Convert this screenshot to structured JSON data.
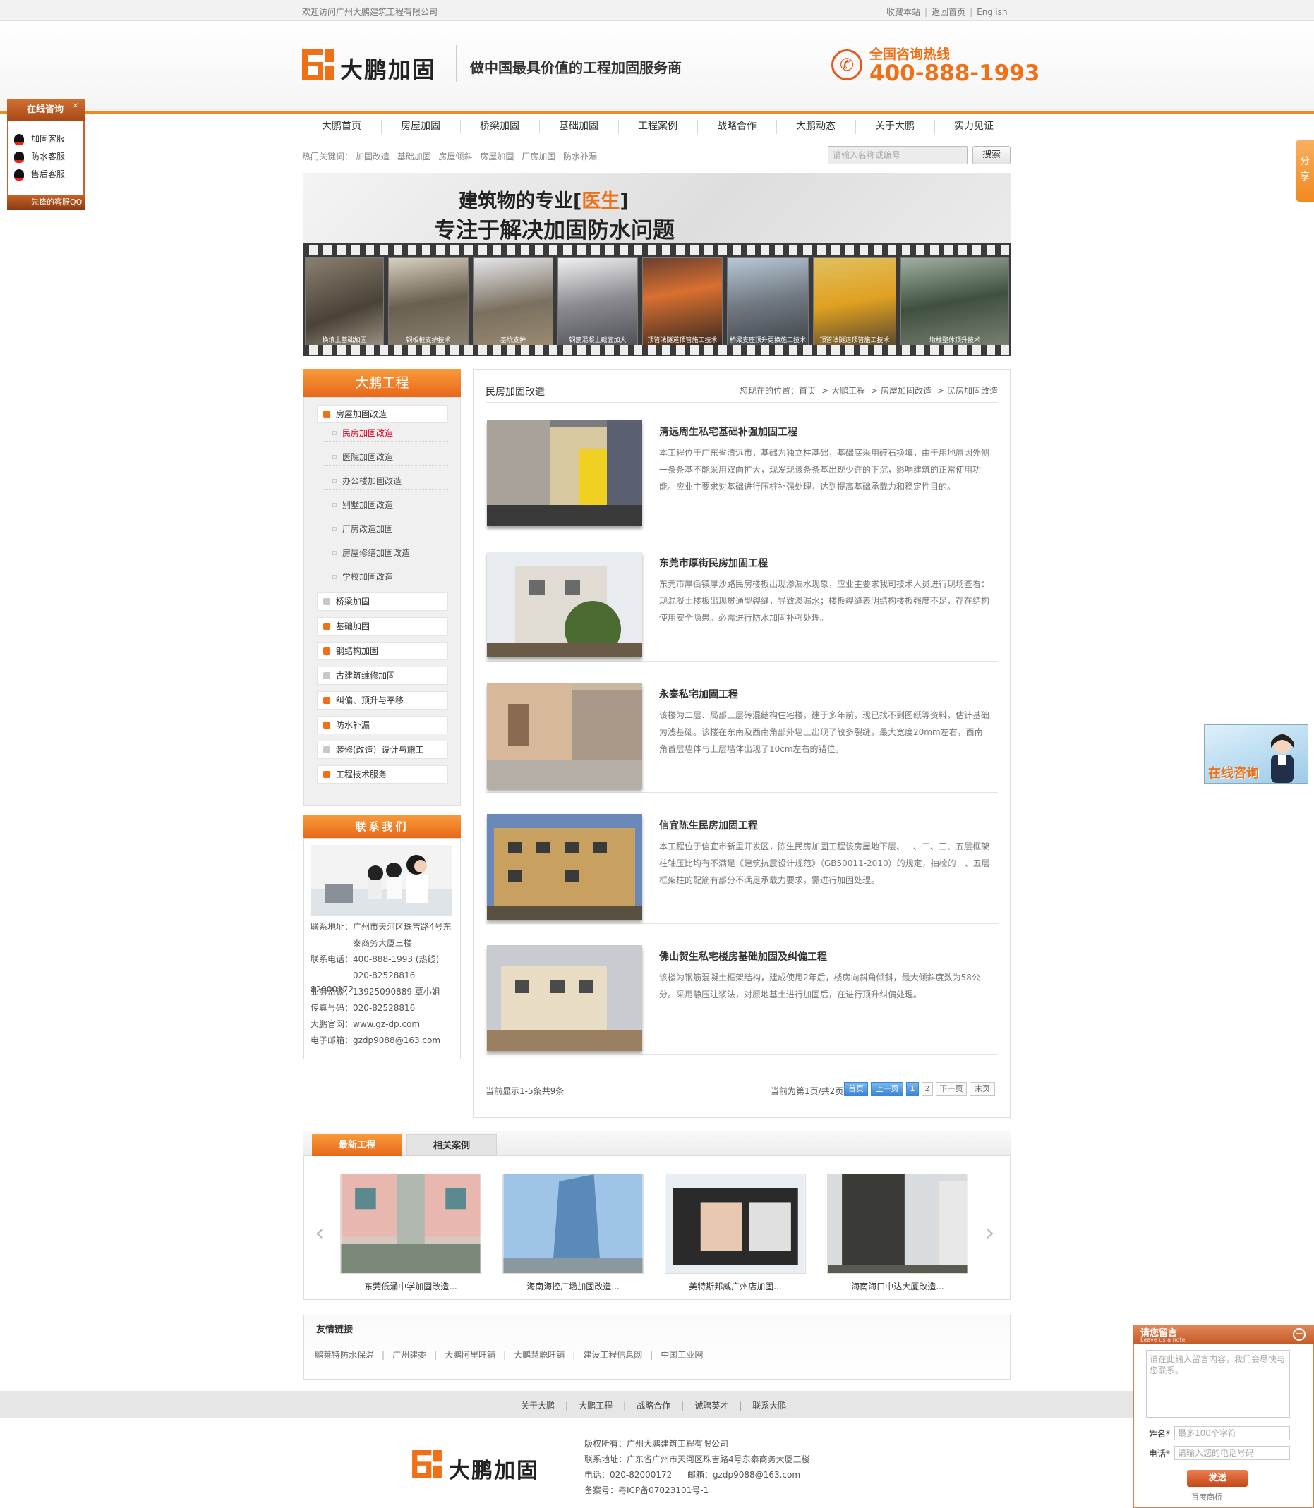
{
  "topbar": {
    "welcome": "欢迎访问广州大鹏建筑工程有限公司",
    "links": [
      "收藏本站",
      "返回首页",
      "English"
    ]
  },
  "header": {
    "logo_text": "大鹏加固",
    "slogan": "做中国最具价值的工程加固服务商",
    "hotline_label": "全国咨询热线",
    "hotline_number": "400-888-1993",
    "accent_color": "#f07018"
  },
  "nav": [
    "大鹏首页",
    "房屋加固",
    "桥梁加固",
    "基础加固",
    "工程案例",
    "战略合作",
    "大鹏动态",
    "关于大鹏",
    "实力见证"
  ],
  "hot_keywords": {
    "label": "热门关键词：",
    "items": [
      "加固改造",
      "基础加固",
      "房屋倾斜",
      "房屋加固",
      "厂房加固",
      "防水补漏"
    ]
  },
  "search": {
    "placeholder": "请输入名称或编号",
    "button": "搜索"
  },
  "banner": {
    "line1_pre": "建筑物的专业[",
    "line1_hl": "医生",
    "line1_post": "]",
    "line2": "专注于解决加固防水问题",
    "captions": [
      "换填土基础加固",
      "钢板桩支护技术",
      "基坑支护",
      "钢筋混凝土截面加大",
      "顶管法隧道顶管施工技术",
      "桥梁支座顶升更换施工技术",
      "顶管法隧道顶管施工技术",
      "墩柱整体顶升技术"
    ]
  },
  "sidebar": {
    "title": "大鹏工程",
    "items": [
      {
        "label": "房屋加固改造",
        "type": "main",
        "arrow": "orange"
      },
      {
        "label": "民房加固改造",
        "type": "sub",
        "active": true
      },
      {
        "label": "医院加固改造",
        "type": "sub"
      },
      {
        "label": "办公楼加固改造",
        "type": "sub"
      },
      {
        "label": "别墅加固改造",
        "type": "sub"
      },
      {
        "label": "厂房改造加固",
        "type": "sub"
      },
      {
        "label": "房屋修缮加固改造",
        "type": "sub"
      },
      {
        "label": "学校加固改造",
        "type": "sub"
      },
      {
        "label": "桥梁加固",
        "type": "main",
        "arrow": "grey"
      },
      {
        "label": "基础加固",
        "type": "main",
        "arrow": "orange"
      },
      {
        "label": "钢结构加固",
        "type": "main",
        "arrow": "orange"
      },
      {
        "label": "古建筑维修加固",
        "type": "main",
        "arrow": "grey"
      },
      {
        "label": "纠偏、顶升与平移",
        "type": "main",
        "arrow": "orange"
      },
      {
        "label": "防水补漏",
        "type": "main",
        "arrow": "orange"
      },
      {
        "label": "装修(改造）设计与施工",
        "type": "main",
        "arrow": "grey"
      },
      {
        "label": "工程技术服务",
        "type": "main",
        "arrow": "orange"
      }
    ]
  },
  "contact": {
    "title": "联系我们",
    "lines": [
      "联系地址：广州市天河区珠吉路4号东",
      "　　　　　泰商务大厦三楼",
      "联系电话：400-888-1993 (热线)",
      "　　　　　020-82528816 82000172",
      "业务洽谈：13925090889 覃小姐",
      "传真号码：020-82528816",
      "大鹏官网：www.gz-dp.com",
      "电子邮箱：gzdp9088@163.com"
    ]
  },
  "main": {
    "title": "民房加固改造",
    "breadcrumb": "您现在的位置：首页 -> 大鹏工程 -> 房屋加固改造 -> 民房加固改造",
    "projects": [
      {
        "title": "清远周生私宅基础补强加固工程",
        "desc": "本工程位于广东省清远市，基础为独立柱基础，基础底采用碎石换填，由于用地原因外侧一条条基不能采用双向扩大，现发现该条条基出现少许的下沉，影响建筑的正常使用功能。应业主要求对基础进行压桩补强处理，达到提高基础承载力和稳定性目的。"
      },
      {
        "title": "东莞市厚街民房加固工程",
        "desc": "东莞市厚街镇厚沙路民房楼板出现渗漏水现象，应业主要求我司技术人员进行现场查看：现混凝土楼板出现贯通型裂缝，导致渗漏水；楼板裂缝表明结构楼板强度不足，存在结构使用安全隐患。必需进行防水加固补强处理。"
      },
      {
        "title": "永泰私宅加固工程",
        "desc": "该楼为二层、局部三层砖混结构住宅楼，建于多年前，现已找不到图纸等资料，估计基础为浅基础。该楼在东南及西南角部外墙上出现了较多裂缝，最大宽度20mm左右，西南角首层墙体与上层墙体出现了10cm左右的错位。"
      },
      {
        "title": "信宜陈生民房加固工程",
        "desc": "本工程位于信宜市新里开发区，陈生民房加固工程该房屋地下层、一、二、三、五层框架柱轴压比均有不满足《建筑抗震设计规范》（GB50011-2010）的规定，抽检的一、五层框架柱的配筋有部分不满足承载力要求，需进行加固处理。"
      },
      {
        "title": "佛山贺生私宅楼房基础加固及纠偏工程",
        "desc": "该楼为钢筋混凝土框架结构，建成使用2年后，楼房向斜角倾斜，最大倾斜度数为58公分。采用静压注浆法，对原地基土进行加固后，在进行顶升纠偏处理。"
      }
    ],
    "count_text": "当前显示1-5条共9条",
    "page_info": "当前为第1页/共2页",
    "pager": [
      "首页",
      "上一页",
      "1",
      "2",
      "下一页",
      "末页"
    ]
  },
  "tabs": {
    "latest": "最新工程",
    "related": "相关案例",
    "cases": [
      "东莞低涌中学加固改造...",
      "海南海控广场加固改造...",
      "美特斯邦威广州店加固...",
      "海南海口中达大厦改造..."
    ]
  },
  "friend_links": {
    "title": "友情链接",
    "items": [
      "鹏莱特防水保温",
      "广州建委",
      "大鹏阿里旺铺",
      "大鹏慧聪旺铺",
      "建设工程信息网",
      "中国工业网"
    ]
  },
  "footer": {
    "nav": [
      "关于大鹏",
      "大鹏工程",
      "战略合作",
      "诚聘英才",
      "联系大鹏"
    ],
    "logo_text": "大鹏加固",
    "copyright": "版权所有：广州大鹏建筑工程有限公司",
    "address": "联系地址：广东省广州市天河区珠吉路4号东泰商务大厦三楼",
    "phone": "电话：020-82000172",
    "email": "邮箱：gzdp9088@163.com",
    "icp": "备案号：粤ICP备07023101号-1"
  },
  "qq_panel": {
    "title": "在线咨询",
    "items": [
      "加固客服",
      "防水客服",
      "售后客服"
    ],
    "footer": "先锋的客服QQ"
  },
  "share_tab": "分享",
  "online_consult": "在线咨询",
  "message_panel": {
    "title": "请您留言",
    "subtitle": "Leave us a note",
    "textarea_placeholder": "请在此输入留言内容，我们会尽快与您联系。",
    "name_label": "姓名*",
    "name_placeholder": "最多100个字符",
    "phone_label": "电话*",
    "phone_placeholder": "请输入您的电话号码",
    "send": "发送",
    "powered": "百度商桥"
  }
}
